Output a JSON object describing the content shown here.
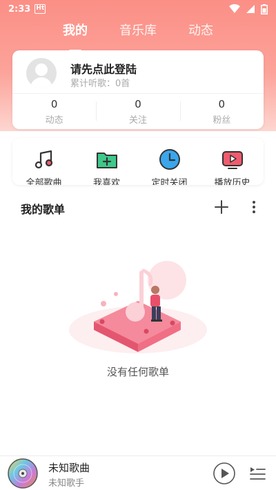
{
  "status_bar": {
    "time": "2:33",
    "app_badge": "Ht"
  },
  "tabs": [
    {
      "label": "我的",
      "active": true
    },
    {
      "label": "音乐库",
      "active": false
    },
    {
      "label": "动态",
      "active": false
    }
  ],
  "profile": {
    "login_prompt": "请先点此登陆",
    "listen_count": "累计听歌：0首",
    "stats": [
      {
        "value": "0",
        "label": "动态"
      },
      {
        "value": "0",
        "label": "关注"
      },
      {
        "value": "0",
        "label": "粉丝"
      }
    ]
  },
  "quick_actions": [
    {
      "label": "全部歌曲",
      "icon": "music-note-icon"
    },
    {
      "label": "我喜欢",
      "icon": "folder-add-icon"
    },
    {
      "label": "定时关闭",
      "icon": "clock-icon"
    },
    {
      "label": "播放历史",
      "icon": "play-history-icon"
    }
  ],
  "playlists": {
    "title": "我的歌单",
    "empty_text": "没有任何歌单"
  },
  "player": {
    "title": "未知歌曲",
    "artist": "未知歌手"
  },
  "colors": {
    "header_top": "#fb8f86",
    "header_bottom": "#fdd6d0",
    "accent_pink": "#f0607a"
  }
}
